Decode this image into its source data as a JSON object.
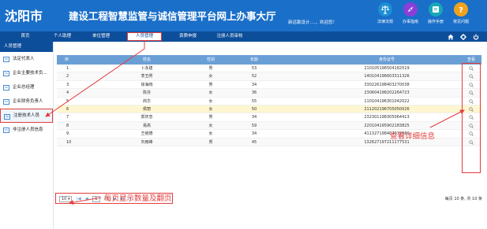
{
  "header": {
    "title": "沈阳市",
    "subtitle": "建设工程智慧监管与诚信管理平台网上办事大厅",
    "welcome": "新远勘设计....，欢迎您！",
    "tools": [
      {
        "label": "法律法规",
        "icon": "scales-icon",
        "color": "#1d8fd6"
      },
      {
        "label": "办事指南",
        "icon": "compass-icon",
        "color": "#8b3fd9"
      },
      {
        "label": "操作手册",
        "icon": "book-icon",
        "color": "#17a7b8"
      },
      {
        "label": "常见问题",
        "icon": "question-icon",
        "color": "#f0a21b"
      }
    ]
  },
  "nav": {
    "items": [
      "首页",
      "个人助理",
      "单位管理",
      "人员管理",
      "资质申报",
      "注册人员审核"
    ],
    "active_index": 3
  },
  "sidebar": {
    "heading": "人员管理",
    "items": [
      "法定代表人",
      "企业主要技术负...",
      "企业总经理",
      "企业财务负责人",
      "注册技术人员",
      "非注册人员信息"
    ],
    "active_index": 4
  },
  "table": {
    "columns": [
      "序",
      "姓名",
      "性别",
      "年龄",
      "身份证号",
      "查看"
    ],
    "rows": [
      {
        "no": "1",
        "name": "卜永建",
        "sex": "男",
        "age": "53",
        "id": "210105196504182519"
      },
      {
        "no": "2",
        "name": "李丑男",
        "sex": "女",
        "age": "52",
        "id": "140104196603311326"
      },
      {
        "no": "3",
        "name": "徐海晓",
        "sex": "男",
        "age": "34",
        "id": "330226198403270038"
      },
      {
        "no": "4",
        "name": "陈芬",
        "sex": "女",
        "age": "36",
        "id": "230604198202264723"
      },
      {
        "no": "5",
        "name": "商华",
        "sex": "女",
        "age": "55",
        "id": "110104196301042022"
      },
      {
        "no": "6",
        "name": "侯丽",
        "sex": "女",
        "age": "50",
        "id": "211202196705050026"
      },
      {
        "no": "7",
        "name": "郭庆忠",
        "sex": "男",
        "age": "34",
        "id": "232301198305064413"
      },
      {
        "no": "8",
        "name": "易高",
        "sex": "女",
        "age": "59",
        "id": "220104195902183825"
      },
      {
        "no": "9",
        "name": "王继德",
        "sex": "女",
        "age": "34",
        "id": "411327198407072560"
      },
      {
        "no": "10",
        "name": "刘雨峰",
        "sex": "男",
        "age": "45",
        "id": "132627197211177531"
      }
    ],
    "highlight_index": 5
  },
  "pager": {
    "page_size": "10",
    "current_page": "1",
    "total_pages_label": "/ 1",
    "summary": "每页 10 条, 共 10 条"
  },
  "annotations": {
    "view_details": "查看详细信息",
    "paging": "每页显示数量及翻页"
  },
  "colors": {
    "header": "#1a6fc9",
    "nav": "#0d4e9a",
    "table_header": "#6a9fd5",
    "annotation": "#e23c3c"
  }
}
